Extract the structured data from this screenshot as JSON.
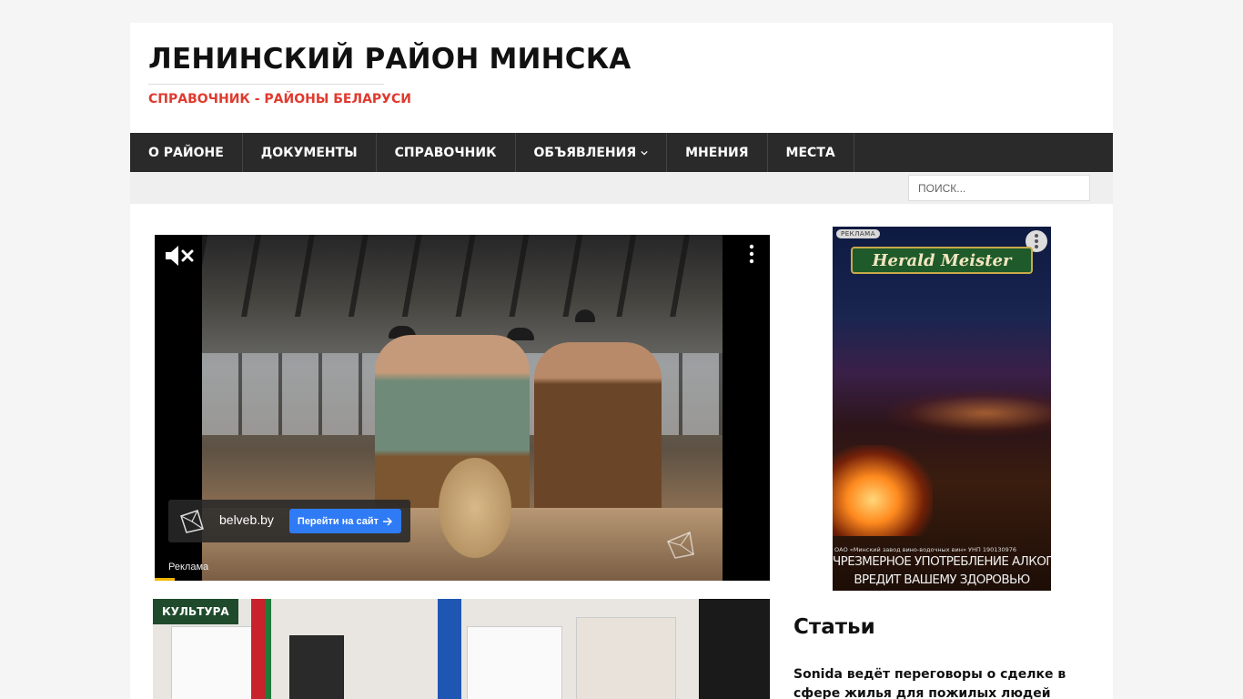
{
  "header": {
    "site_title": "ЛЕНИНСКИЙ РАЙОН МИНСКА",
    "site_description": "СПРАВОЧНИК - РАЙОНЫ БЕЛАРУСИ"
  },
  "nav": {
    "items": [
      {
        "label": "О РАЙОНЕ"
      },
      {
        "label": "ДОКУМЕНТЫ"
      },
      {
        "label": "СПРАВОЧНИК"
      },
      {
        "label": "ОБЪЯВЛЕНИЯ",
        "has_dropdown": true
      },
      {
        "label": "МНЕНИЯ"
      },
      {
        "label": "МЕСТА"
      }
    ]
  },
  "search": {
    "placeholder": "ПОИСК..."
  },
  "video_ad": {
    "domain": "belveb.by",
    "cta_label": "Перейти на сайт",
    "ad_label": "Реклама",
    "progress_fraction": 0.033,
    "icons": [
      "mute-icon",
      "kebab-menu-icon",
      "belveb-logo-icon",
      "arrow-right-icon"
    ]
  },
  "featured_post": {
    "category": "КУЛЬТУРА"
  },
  "sidebar_ad": {
    "label": "РЕКЛАМА",
    "brand": "Herald Meister",
    "small_print": "ОАО «Минский завод вино-водочных вин» УНП 190130976",
    "warning_line1": "ЧРЕЗМЕРНОЕ УПОТРЕБЛЕНИЕ АЛКОГОЛЯ",
    "warning_line2": "ВРЕДИТ ВАШЕМУ ЗДОРОВЬЮ"
  },
  "sidebar": {
    "widget_title": "Статьи",
    "articles": [
      {
        "title": "Sonida ведёт переговоры о сделке в сфере жилья для пожилых людей"
      }
    ]
  },
  "colors": {
    "nav_bg": "#2a2a2a",
    "accent_red": "#e03a2f",
    "category_badge": "#1f4a2c",
    "cta_blue": "#2f7bf5",
    "progress_yellow": "#f1b500"
  }
}
